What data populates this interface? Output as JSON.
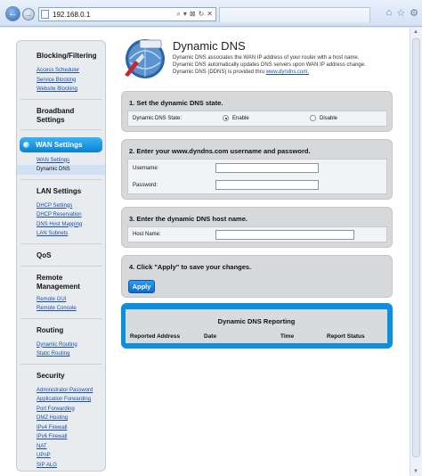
{
  "browser": {
    "url": "192.168.0.1",
    "address_tools": [
      "⌕",
      "▾",
      "⊠",
      "↻",
      "✕"
    ],
    "icons": [
      "home-icon",
      "star-icon",
      "gear-icon"
    ]
  },
  "sidebar": {
    "sections": {
      "blocking": {
        "title": "Blocking/Filtering",
        "links": [
          "Access Scheduler",
          "Service Blocking",
          "Website Blocking"
        ]
      },
      "broadband": {
        "title": "Broadband Settings"
      },
      "wan": {
        "title": "WAN Settings",
        "links": [
          "WAN Settings",
          "Dynamic DNS"
        ]
      },
      "lan": {
        "title": "LAN Settings",
        "links": [
          "DHCP Settings",
          "DHCP Reservation",
          "DNS Host Mapping",
          "LAN Subnets"
        ]
      },
      "qos": {
        "title": "QoS"
      },
      "remote": {
        "title": "Remote Management",
        "links": [
          "Remote GUI",
          "Remote Console"
        ]
      },
      "routing": {
        "title": "Routing",
        "links": [
          "Dynamic Routing",
          "Static Routing"
        ]
      },
      "security": {
        "title": "Security",
        "links": [
          "Administrator Password",
          "Application Forwarding",
          "Port Forwarding",
          "DMZ Hosting",
          "IPv4 Firewall",
          "IPv6 Firewall",
          "NAT",
          "UPnP",
          "SIP ALG"
        ]
      }
    }
  },
  "header": {
    "title": "Dynamic DNS",
    "desc_line1": "Dynamic DNS associates the WAN IP address of your router with a host name.",
    "desc_line2": "Dynamic DNS automatically updates DNS servers upon WAN IP address change.",
    "desc_line3_prefix": "Dynamic DNS (DDNS) is provided thru ",
    "desc_link": "www.dyndns.com."
  },
  "step1": {
    "title": "1. Set the dynamic DNS state.",
    "label": "Dynamic DNS State:",
    "enable": "Enable",
    "disable": "Disable"
  },
  "step2": {
    "title": "2. Enter your www.dyndns.com username and password.",
    "username_label": "Username:",
    "password_label": "Password:",
    "username_value": "",
    "password_value": ""
  },
  "step3": {
    "title": "3. Enter the dynamic DNS host name.",
    "host_label": "Host Name:",
    "host_value": ""
  },
  "step4": {
    "title": "4. Click \"Apply\" to save your changes.",
    "apply_label": "Apply"
  },
  "report": {
    "title": "Dynamic DNS Reporting",
    "columns": [
      "Reported Address",
      "Date",
      "Time",
      "Report Status"
    ]
  }
}
